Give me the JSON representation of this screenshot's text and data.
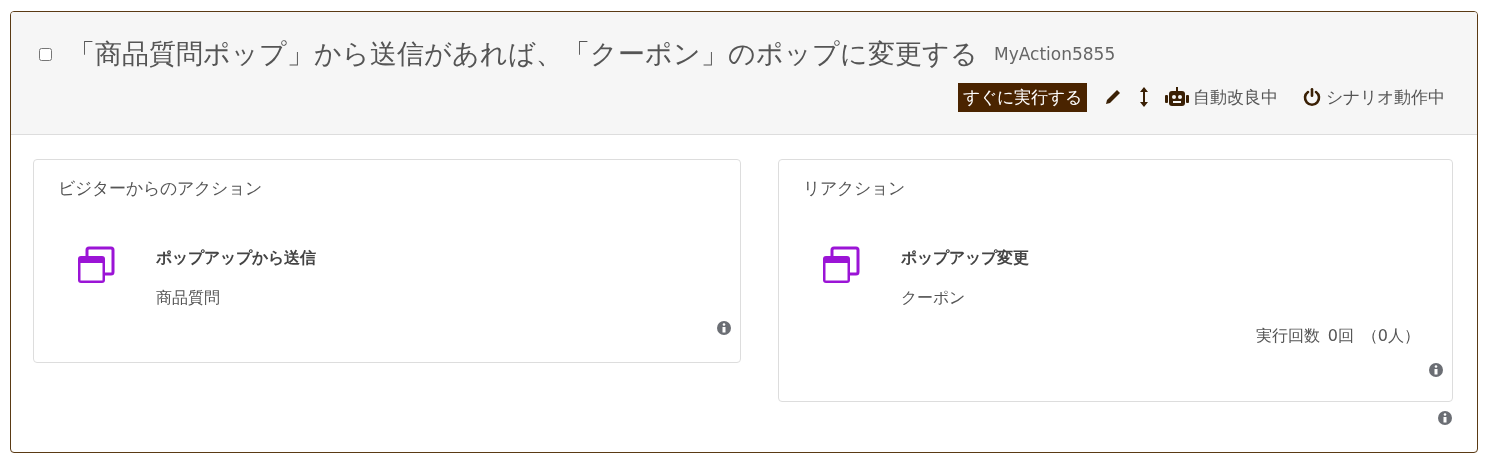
{
  "scenario": {
    "checked": false,
    "title": "「商品質問ポップ」から送信があれば、「クーポン」のポップに変更する",
    "id": "MyAction5855",
    "run_button": "すぐに実行する",
    "auto_improve": "自動改良中",
    "status": "シナリオ動作中"
  },
  "trigger": {
    "heading": "ビジターからのアクション",
    "name": "ポップアップから送信",
    "value": "商品質問"
  },
  "reaction": {
    "heading": "リアクション",
    "name": "ポップアップ変更",
    "value": "クーポン",
    "stats_label": "実行回数",
    "count": "0回",
    "people": "（0人）"
  }
}
